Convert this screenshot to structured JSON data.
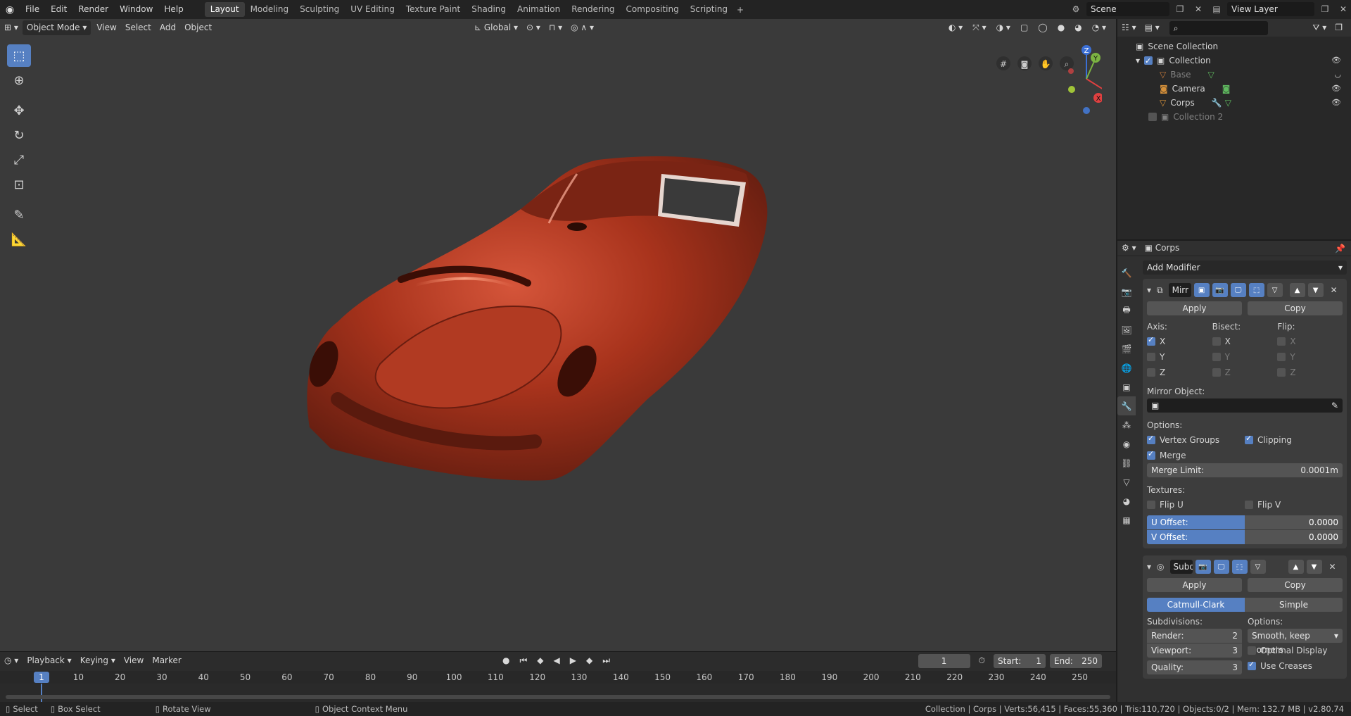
{
  "menu": [
    "File",
    "Edit",
    "Render",
    "Window",
    "Help"
  ],
  "workspaces": [
    "Layout",
    "Modeling",
    "Sculpting",
    "UV Editing",
    "Texture Paint",
    "Shading",
    "Animation",
    "Rendering",
    "Compositing",
    "Scripting"
  ],
  "active_workspace": "Layout",
  "scene": "Scene",
  "view_layer": "View Layer",
  "viewport": {
    "mode": "Object Mode",
    "menus": [
      "View",
      "Select",
      "Add",
      "Object"
    ],
    "transform_orientation": "Global"
  },
  "outliner": {
    "root": "Scene Collection",
    "items": [
      {
        "name": "Collection"
      },
      {
        "name": "Base"
      },
      {
        "name": "Camera"
      },
      {
        "name": "Corps"
      },
      {
        "name": "Collection 2"
      }
    ]
  },
  "properties": {
    "object": "Corps",
    "add_modifier": "Add Modifier",
    "mirror": {
      "name": "Mirr",
      "apply": "Apply",
      "copy": "Copy",
      "axis_label": "Axis:",
      "bisect_label": "Bisect:",
      "flip_label": "Flip:",
      "axes": [
        "X",
        "Y",
        "Z"
      ],
      "axis_checked": [
        true,
        false,
        false
      ],
      "mirror_object_label": "Mirror Object:",
      "options_label": "Options:",
      "vertex_groups": "Vertex Groups",
      "clipping": "Clipping",
      "merge": "Merge",
      "merge_limit_label": "Merge Limit:",
      "merge_limit": "0.0001m",
      "textures_label": "Textures:",
      "flip_u": "Flip U",
      "flip_v": "Flip V",
      "u_offset_label": "U Offset:",
      "u_offset": "0.0000",
      "v_offset_label": "V Offset:",
      "v_offset": "0.0000"
    },
    "subsurf": {
      "name": "Subd",
      "apply": "Apply",
      "copy": "Copy",
      "catmull": "Catmull-Clark",
      "simple": "Simple",
      "subdivisions_label": "Subdivisions:",
      "options_label": "Options:",
      "render_label": "Render:",
      "render": "2",
      "viewport_label": "Viewport:",
      "viewport": "3",
      "quality_label": "Quality:",
      "quality": "3",
      "uv_smooth": "Smooth, keep corners",
      "optimal_display": "Optimal Display",
      "use_creases": "Use Creases"
    }
  },
  "timeline": {
    "menus": [
      "Playback",
      "Keying",
      "View",
      "Marker"
    ],
    "current_frame": "1",
    "start_label": "Start:",
    "start": "1",
    "end_label": "End:",
    "end": "250",
    "ticks": [
      "10",
      "20",
      "30",
      "40",
      "50",
      "60",
      "70",
      "80",
      "90",
      "100",
      "110",
      "120",
      "130",
      "140",
      "150",
      "160",
      "170",
      "180",
      "190",
      "200",
      "210",
      "220",
      "230",
      "240",
      "250"
    ]
  },
  "statusbar": {
    "select": "Select",
    "box_select": "Box Select",
    "rotate_view": "Rotate View",
    "context_menu": "Object Context Menu",
    "stats": "Collection | Corps | Verts:56,415 | Faces:55,360 | Tris:110,720 | Objects:0/2 | Mem: 132.7 MB | v2.80.74"
  },
  "colors": {
    "accent": "#5680c2",
    "viewport_bg": "#3a3a3a",
    "car_body": "#b83a22"
  }
}
